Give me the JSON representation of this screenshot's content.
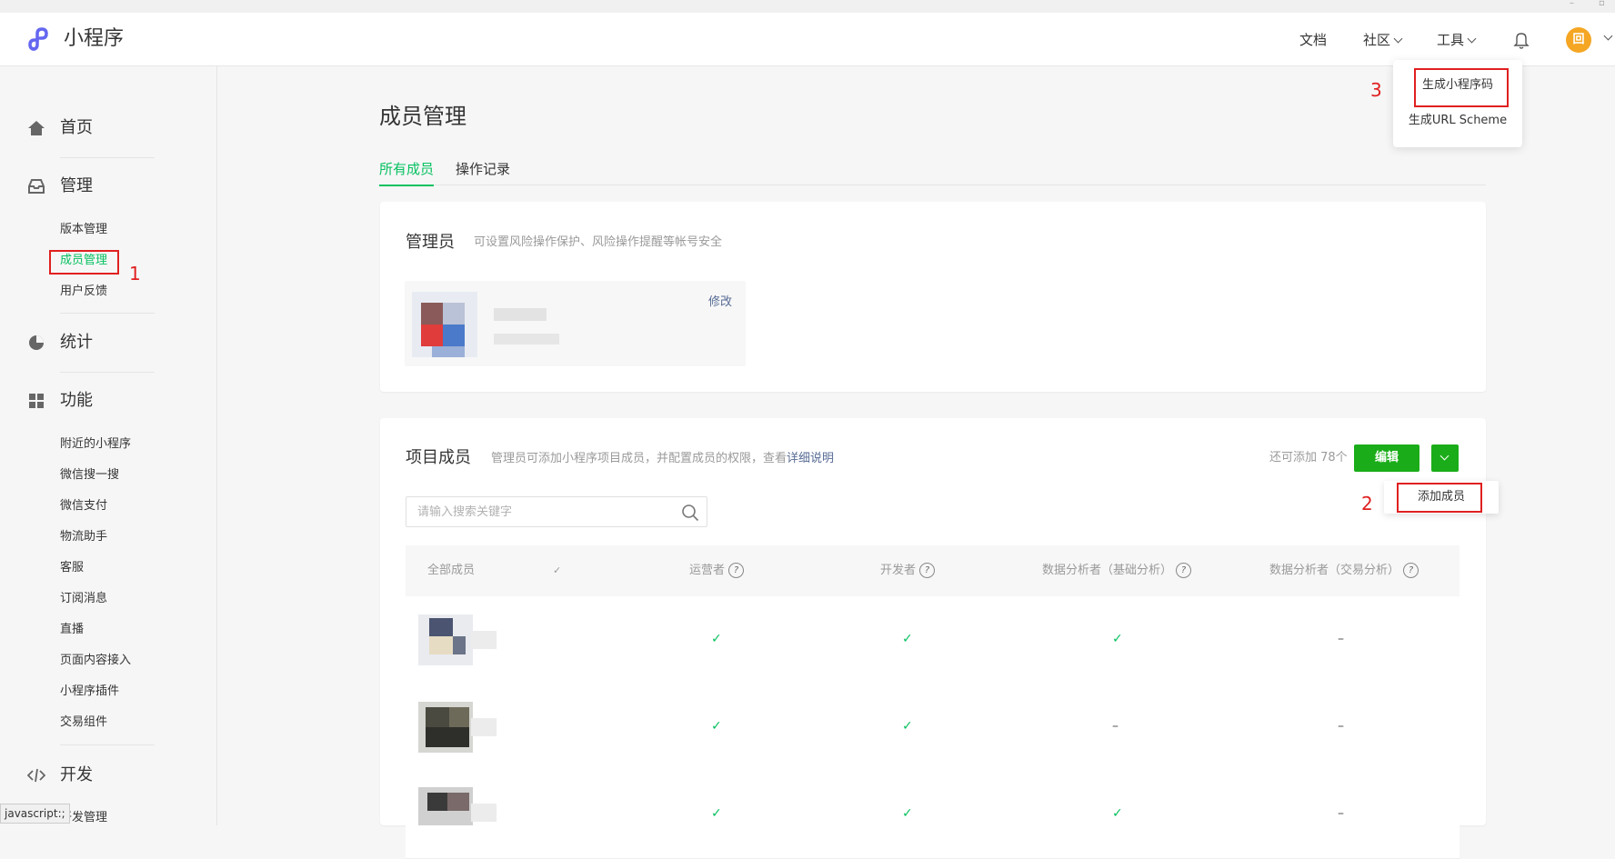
{
  "header": {
    "app_name": "小程序",
    "nav": {
      "docs": "文档",
      "community": "社区",
      "tools": "工具"
    },
    "avatar_text": "回"
  },
  "tools_menu": {
    "items": [
      "生成小程序码",
      "生成URL Scheme"
    ]
  },
  "annotations": {
    "n1": "1",
    "n2": "2",
    "n3": "3"
  },
  "sidebar": {
    "home": "首页",
    "manage": {
      "label": "管理",
      "items": [
        "版本管理",
        "成员管理",
        "用户反馈"
      ]
    },
    "stats": "统计",
    "features": {
      "label": "功能",
      "items": [
        "附近的小程序",
        "微信搜一搜",
        "微信支付",
        "物流助手",
        "客服",
        "订阅消息",
        "直播",
        "页面内容接入",
        "小程序插件",
        "交易组件"
      ]
    },
    "dev": {
      "label": "开发",
      "items": [
        "开发管理"
      ]
    }
  },
  "status_bar": "javascript:;",
  "main": {
    "title": "成员管理",
    "tabs": [
      "所有成员",
      "操作记录"
    ],
    "admin": {
      "title": "管理员",
      "desc": "可设置风险操作保护、风险操作提醒等帐号安全",
      "edit": "修改"
    },
    "members": {
      "title": "项目成员",
      "desc": "管理员可添加小程序项目成员，并配置成员的权限，查看",
      "desc_link": "详细说明",
      "quota": "还可添加 78个",
      "edit_button": "编辑",
      "add_member": "添加成员",
      "search_placeholder": "请输入搜索关键字",
      "columns": [
        "全部成员",
        "运营者",
        "开发者",
        "数据分析者（基础分析）",
        "数据分析者（交易分析）"
      ],
      "rows": [
        [
          "✓",
          "✓",
          "✓",
          "–"
        ],
        [
          "✓",
          "✓",
          "–",
          "–"
        ],
        [
          "✓",
          "✓",
          "✓",
          "–"
        ]
      ]
    }
  }
}
